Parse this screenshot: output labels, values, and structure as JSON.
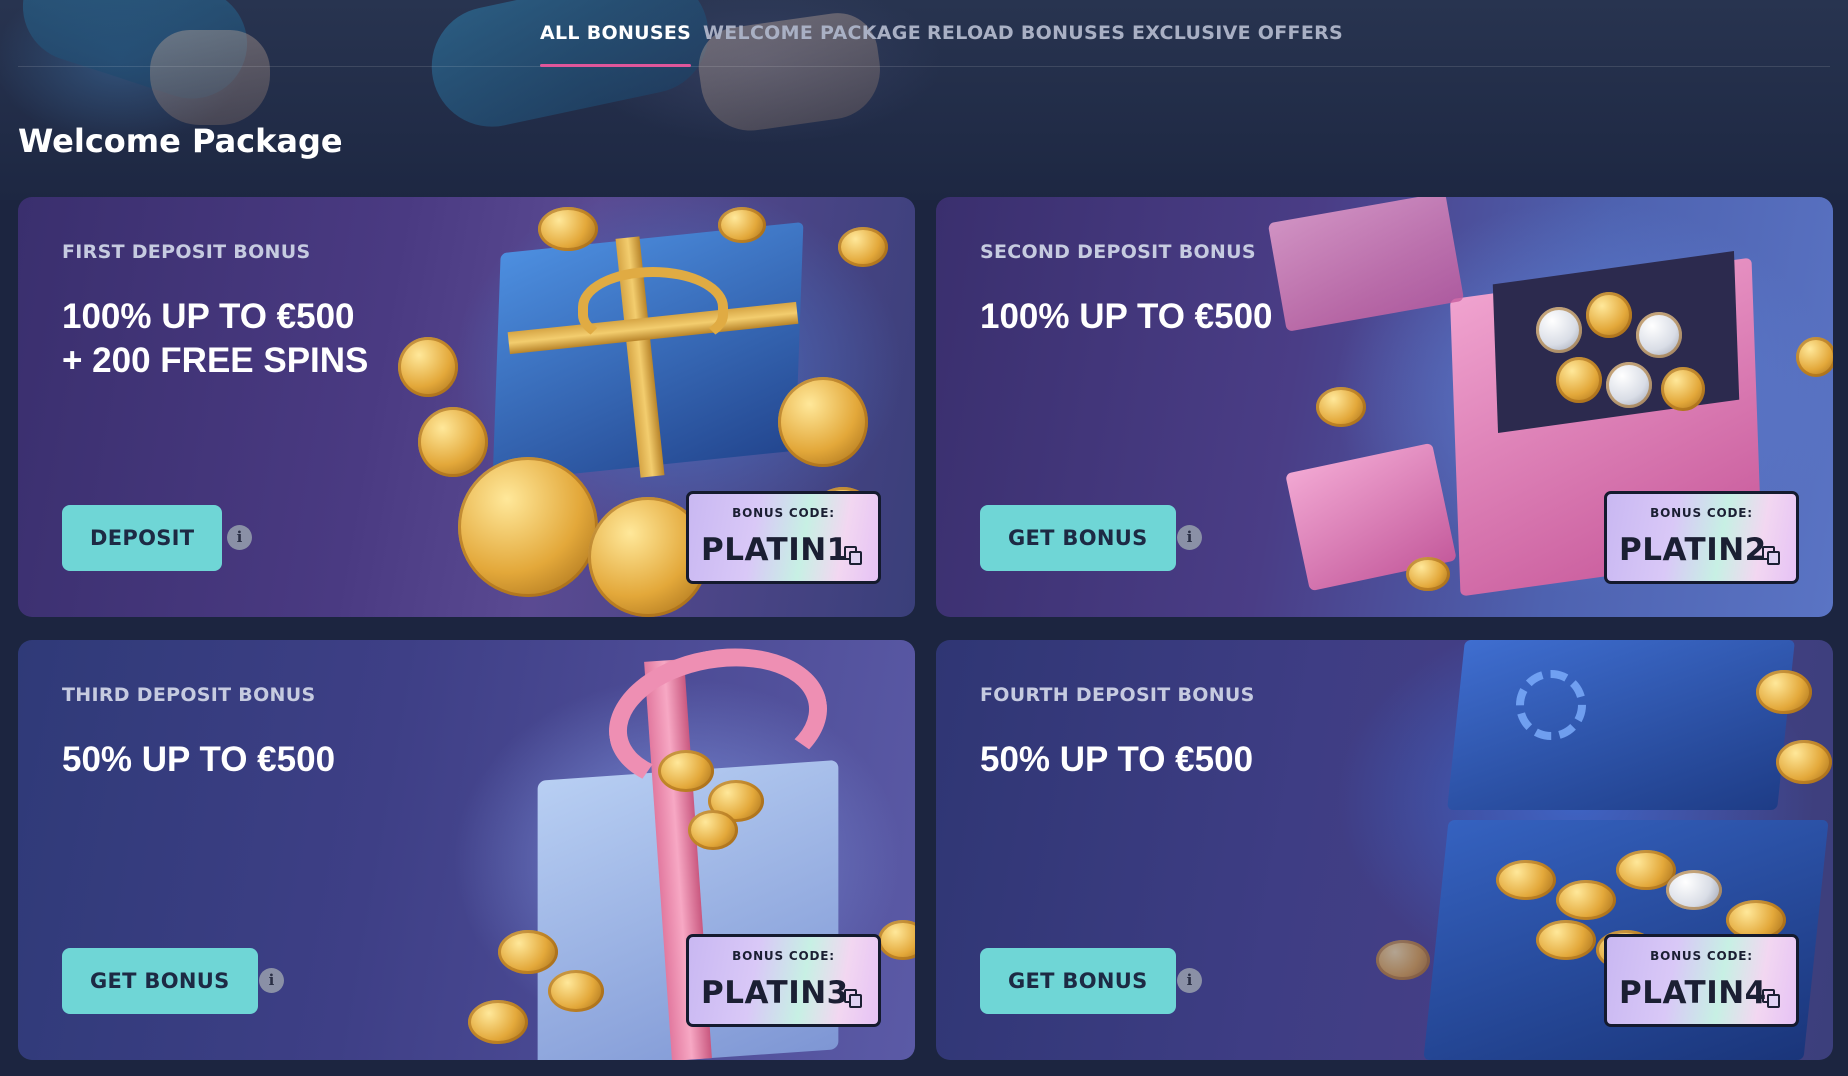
{
  "tabs": [
    {
      "label": "ALL BONUSES",
      "active": true
    },
    {
      "label": "WELCOME PACKAGE",
      "active": false
    },
    {
      "label": "RELOAD BONUSES",
      "active": false
    },
    {
      "label": "EXCLUSIVE OFFERS",
      "active": false
    }
  ],
  "section": {
    "title": "Welcome Package"
  },
  "cards": [
    {
      "label": "FIRST DEPOSIT BONUS",
      "offer": "100% UP TO €500\n+ 200 FREE SPINS",
      "button": "DEPOSIT",
      "code_label": "BONUS CODE:",
      "code": "PLATIN1"
    },
    {
      "label": "SECOND DEPOSIT BONUS",
      "offer": "100% UP TO €500",
      "button": "GET BONUS",
      "code_label": "BONUS CODE:",
      "code": "PLATIN2"
    },
    {
      "label": "THIRD DEPOSIT BONUS",
      "offer": "50% UP TO €500",
      "button": "GET BONUS",
      "code_label": "BONUS CODE:",
      "code": "PLATIN3"
    },
    {
      "label": "FOURTH DEPOSIT BONUS",
      "offer": "50% UP TO €500",
      "button": "GET BONUS",
      "code_label": "BONUS CODE:",
      "code": "PLATIN4"
    }
  ],
  "icons": {
    "info": "info-icon",
    "copy": "copy-icon"
  },
  "colors": {
    "accent_button": "#6fd6d6",
    "active_tab_underline": "#e0569a",
    "background": "#1c2540"
  }
}
